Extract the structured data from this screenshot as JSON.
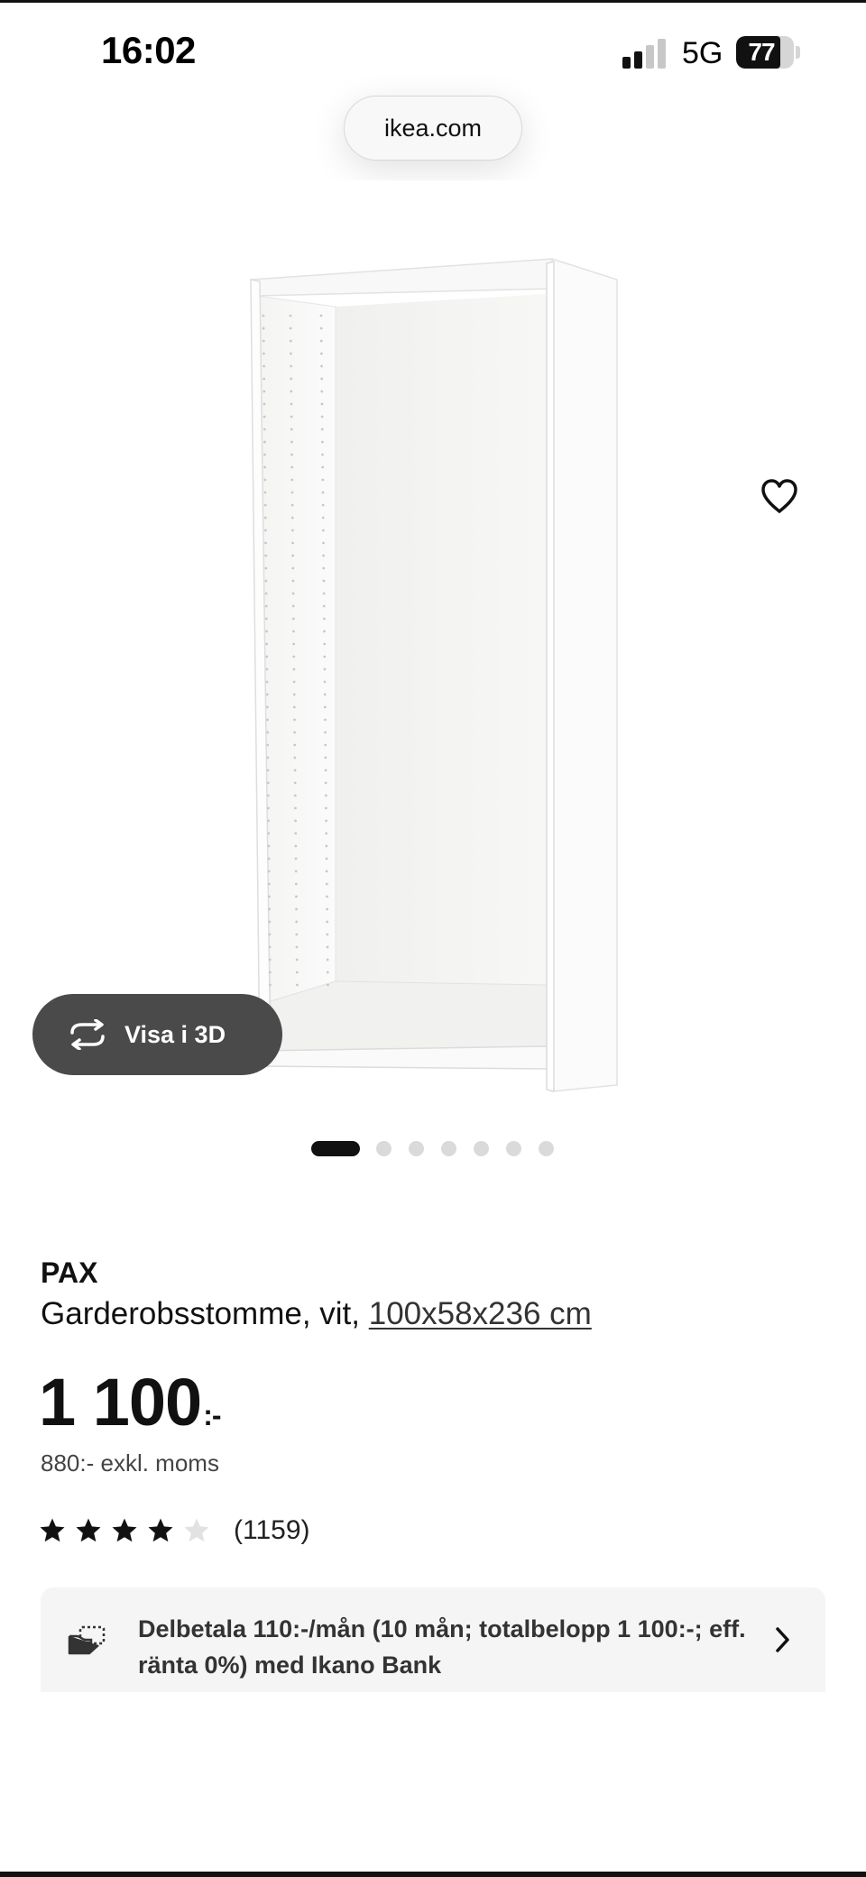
{
  "status_bar": {
    "time": "16:02",
    "network": "5G",
    "battery": "77",
    "battery_level": 0.77,
    "signal_bars_active": 2,
    "signal_bars_total": 4
  },
  "browser": {
    "url": "ikea.com"
  },
  "gallery": {
    "favorite_icon": "heart-outline-icon",
    "view_3d_icon": "rotate-arrows-icon",
    "view_3d_label": "Visa i 3D",
    "dot_count": 7,
    "active_dot": 0
  },
  "product": {
    "brand": "PAX",
    "description": "Garderobsstomme, vit,",
    "size": "100x58x236 cm",
    "price": "1 100",
    "price_suffix": ":-",
    "price_exkl": "880:- exkl. moms",
    "rating": 4,
    "rating_max": 5,
    "review_count": "(1159)"
  },
  "installment": {
    "icon": "payment-hand-icon",
    "text": "Delbetala 110:-/mån (10 mån; totalbelopp 1 100:-; eff. ränta 0%) med Ikano Bank",
    "chevron_icon": "chevron-right-icon"
  }
}
